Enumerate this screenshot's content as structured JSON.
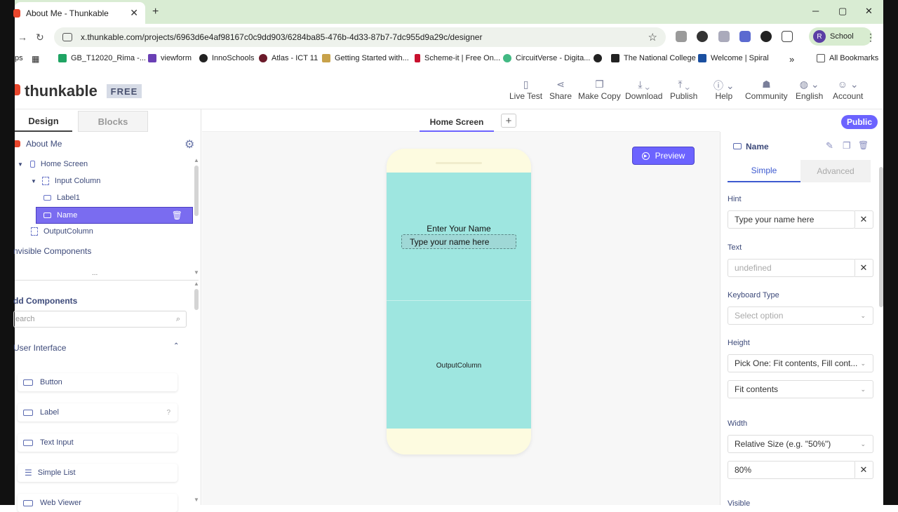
{
  "browser": {
    "tab_title": "About Me - Thunkable",
    "new_tab": "+",
    "url": "x.thunkable.com/projects/6963d6e4af98167c0c9dd903/6284ba85-476b-4d33-87b7-7dc955d9a29c/designer",
    "profile_initial": "R",
    "profile_name": "School",
    "win_min": "─",
    "win_max": "▢",
    "win_close": "✕"
  },
  "bookmarks": [
    {
      "label": "ps",
      "color": "#888"
    },
    {
      "label": "GB_T12020_Rima -...",
      "color": "#1fa463"
    },
    {
      "label": "viewform",
      "color": "#6a3fb5"
    },
    {
      "label": "InnoSchools",
      "color": "#222"
    },
    {
      "label": "Atlas - ICT 11",
      "color": "#6b1a2a"
    },
    {
      "label": "Getting Started with...",
      "color": "#c8a24a"
    },
    {
      "label": "Scheme-it | Free On...",
      "color": "#c8102e"
    },
    {
      "label": "CircuitVerse - Digita...",
      "color": "#42b983"
    },
    {
      "label": "",
      "color": "#222"
    },
    {
      "label": "The National College",
      "color": "#222"
    },
    {
      "label": "Welcome | Spiral",
      "color": "#1a4fa0"
    },
    {
      "label": "All Bookmarks",
      "color": "#555"
    }
  ],
  "app": {
    "logo": "thunkable",
    "plan": "FREE",
    "actions": [
      {
        "label": "Live Test",
        "icon": "phone-icon"
      },
      {
        "label": "Share",
        "icon": "share-icon"
      },
      {
        "label": "Make Copy",
        "icon": "copy-icon"
      },
      {
        "label": "Download",
        "icon": "download-icon"
      },
      {
        "label": "Publish",
        "icon": "upload-icon"
      },
      {
        "label": "Help",
        "icon": "info-icon"
      },
      {
        "label": "Community",
        "icon": "community-icon"
      },
      {
        "label": "English",
        "icon": "globe-icon"
      },
      {
        "label": "Account",
        "icon": "user-icon"
      }
    ]
  },
  "left": {
    "tab_design": "Design",
    "tab_blocks": "Blocks",
    "project": "About Me",
    "tree": {
      "home": "Home Screen",
      "input_column": "Input Column",
      "label1": "Label1",
      "name": "Name",
      "output": "OutputColumn"
    },
    "invisible": "nvisible Components",
    "invisible_more": "...",
    "add": "dd Components",
    "search_placeholder": "earch",
    "ui_section": "User Interface",
    "components": [
      "Button",
      "Label",
      "Text Input",
      "Simple List",
      "Web Viewer"
    ]
  },
  "canvas": {
    "screen_tab": "Home Screen",
    "add_screen": "+",
    "public": "Public",
    "preview": "Preview",
    "label_text": "Enter Your Name",
    "input_text": "Type your name here",
    "output_text": "OutputColumn"
  },
  "props": {
    "title": "Name",
    "tab_simple": "Simple",
    "tab_advanced": "Advanced",
    "hint_label": "Hint",
    "hint_value": "Type your name here",
    "text_label": "Text",
    "text_value": "undefined",
    "keyboard_label": "Keyboard Type",
    "keyboard_value": "Select option",
    "height_label": "Height",
    "height_mode": "Pick One: Fit contents, Fill cont...",
    "height_value": "Fit contents",
    "width_label": "Width",
    "width_mode": "Relative Size (e.g. \"50%\")",
    "width_value": "80%",
    "visible_label": "Visible"
  },
  "colors": {
    "accent": "#6c63ff",
    "phone_bg": "#fdfbe0",
    "column_bg": "#9ee6e0",
    "brand_red": "#e8462c"
  }
}
